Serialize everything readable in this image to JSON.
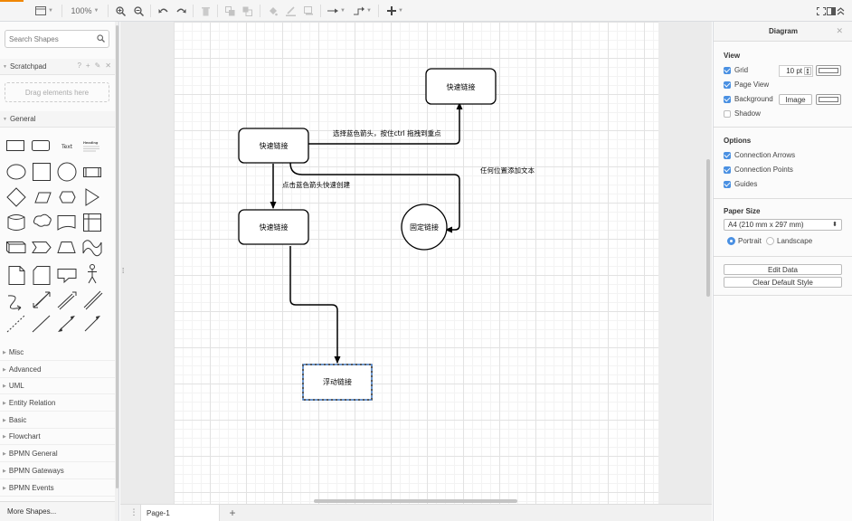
{
  "toolbar": {
    "zoom": "100%",
    "icons": [
      "page-view-icon",
      "zoom-in-icon",
      "zoom-out-icon",
      "undo-icon",
      "redo-icon",
      "delete-icon",
      "to-front-icon",
      "to-back-icon",
      "fill-color-icon",
      "line-color-icon",
      "shadow-icon",
      "connection-icon",
      "waypoints-icon",
      "insert-icon",
      "fullscreen-icon",
      "format-panel-icon",
      "collapse-icon"
    ]
  },
  "sidebar": {
    "search_placeholder": "Search Shapes",
    "scratchpad_label": "Scratchpad",
    "scratchpad_drop": "Drag elements here",
    "general_label": "General",
    "text_shape_label": "Text",
    "heading_shape_label": "Heading",
    "categories": [
      "Misc",
      "Advanced",
      "UML",
      "Entity Relation",
      "Basic",
      "Flowchart",
      "BPMN General",
      "BPMN Gateways",
      "BPMN Events"
    ],
    "more_shapes": "More Shapes..."
  },
  "diagram": {
    "nodes": {
      "top_right": "快速链接",
      "source": "快速链接",
      "below": "快速链接",
      "fixed": "固定链接",
      "floating": "浮动链接"
    },
    "labels": {
      "ctrl_drag": "选择蓝色箭头，按住ctrl 拖拽到重点",
      "click_quick": "点击蓝色箭头快速创建",
      "any_pos": "任何位置添加文本"
    }
  },
  "pages": {
    "current": "Page-1"
  },
  "format_panel": {
    "title": "Diagram",
    "view": {
      "heading": "View",
      "grid_label": "Grid",
      "grid_checked": true,
      "grid_size": "10 pt",
      "page_view_label": "Page View",
      "page_view_checked": true,
      "background_label": "Background",
      "background_checked": true,
      "image_button": "Image",
      "shadow_label": "Shadow",
      "shadow_checked": false
    },
    "options": {
      "heading": "Options",
      "connection_arrows": "Connection Arrows",
      "connection_points": "Connection Points",
      "guides": "Guides"
    },
    "paper": {
      "heading": "Paper Size",
      "size": "A4 (210 mm x 297 mm)",
      "portrait": "Portrait",
      "landscape": "Landscape",
      "orientation": "Portrait"
    },
    "edit_data": "Edit Data",
    "clear_style": "Clear Default Style"
  },
  "colors": {
    "accent": "#4a90e2",
    "brand_orange": "#f08705",
    "selection": "#2b7ce9"
  }
}
